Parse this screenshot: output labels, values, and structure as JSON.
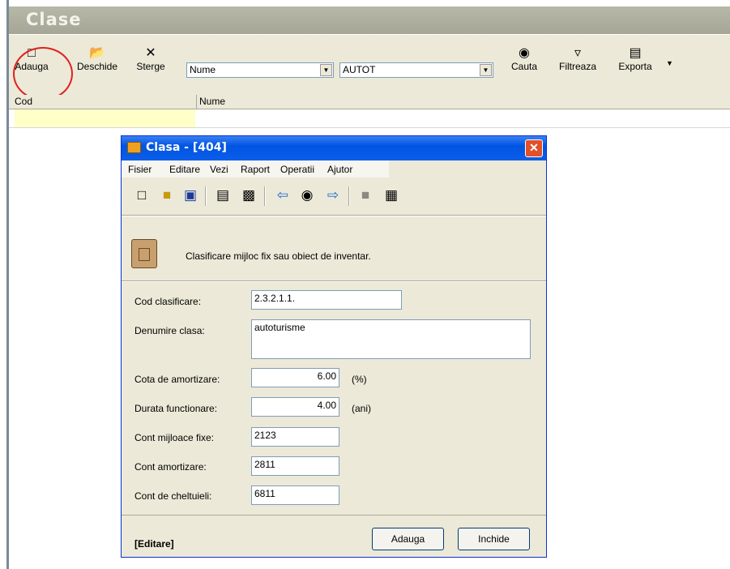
{
  "window": {
    "title": "Clase"
  },
  "toolbar": {
    "buttons": [
      {
        "label": "Adauga",
        "icon": "new-document-icon"
      },
      {
        "label": "Deschide",
        "icon": "open-folder-icon"
      },
      {
        "label": "Sterge",
        "icon": "delete-x-icon"
      },
      {
        "label": "Cauta",
        "icon": "binoculars-icon"
      },
      {
        "label": "Filtreaza",
        "icon": "filter-icon"
      },
      {
        "label": "Exporta",
        "icon": "export-icon"
      }
    ],
    "field_select": "Nume",
    "value_select": "AUTOT"
  },
  "grid": {
    "columns": [
      "Cod",
      "Nume"
    ]
  },
  "dialog": {
    "title": "Clasa - [404]",
    "menu": [
      "Fisier",
      "Editare",
      "Vezi",
      "Raport",
      "Operatii",
      "Ajutor"
    ],
    "description": "Clasificare mijloc fix sau obiect de inventar.",
    "fields": {
      "cod_clasificare": {
        "label": "Cod clasificare:",
        "value": "2.3.2.1.1."
      },
      "denumire_clasa": {
        "label": "Denumire clasa:",
        "value": "autoturisme"
      },
      "cota_amortizare": {
        "label": "Cota de amortizare:",
        "value": "6.00",
        "unit": "(%)"
      },
      "durata_functionare": {
        "label": "Durata functionare:",
        "value": "4.00",
        "unit": "(ani)"
      },
      "cont_mijloace_fixe": {
        "label": "Cont mijloace fixe:",
        "value": "2123"
      },
      "cont_amortizare": {
        "label": "Cont amortizare:",
        "value": "2811"
      },
      "cont_cheltuieli": {
        "label": "Cont de cheltuieli:",
        "value": "6811"
      }
    },
    "status": "[Editare]",
    "buttons": {
      "add": "Adauga",
      "close": "Inchide"
    }
  },
  "colors": {
    "highlight_row": "#ffffc8",
    "annotation_circle": "#e02020",
    "xp_blue": "#0054e3"
  }
}
